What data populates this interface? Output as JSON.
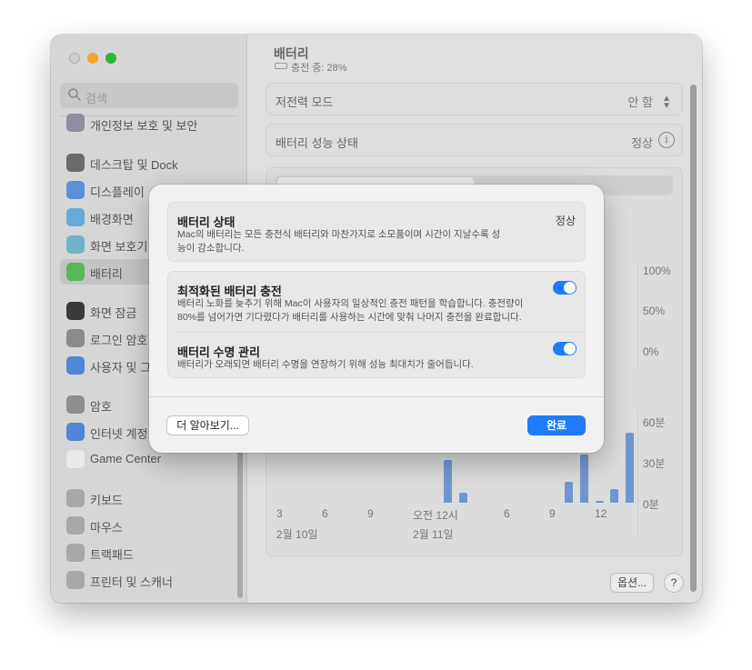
{
  "sidebar": {
    "search_placeholder": "검색",
    "items": [
      {
        "label": "개인정보 보호 및 보안",
        "icon": "hand-icon"
      },
      {
        "label": "데스크탑 및 Dock",
        "icon": "dock-icon"
      },
      {
        "label": "디스플레이",
        "icon": "display-icon"
      },
      {
        "label": "배경화면",
        "icon": "wallpaper-icon"
      },
      {
        "label": "화면 보호기",
        "icon": "screensaver-icon"
      },
      {
        "label": "배터리",
        "icon": "battery-icon",
        "selected": true
      },
      {
        "label": "화면 잠금",
        "icon": "lock-icon"
      },
      {
        "label": "로그인 암호",
        "icon": "lock-icon"
      },
      {
        "label": "사용자 및 그",
        "icon": "users-icon"
      },
      {
        "label": "암호",
        "icon": "key-icon"
      },
      {
        "label": "인터넷 계정",
        "icon": "at-icon"
      },
      {
        "label": "Game Center",
        "icon": "game-center-icon"
      },
      {
        "label": "키보드",
        "icon": "keyboard-icon"
      },
      {
        "label": "마우스",
        "icon": "mouse-icon"
      },
      {
        "label": "트랙패드",
        "icon": "trackpad-icon"
      },
      {
        "label": "프린터 및 스캐너",
        "icon": "printer-icon"
      }
    ]
  },
  "main": {
    "title": "배터리",
    "subtitle": "충전 중: 28%",
    "low_power_label": "저전력 모드",
    "low_power_value": "안 함",
    "health_label": "배터리 성능 상태",
    "health_value": "정상",
    "chart": {
      "level_ticks": [
        "100%",
        "50%",
        "0%"
      ],
      "usage_ticks": [
        "60분",
        "30분",
        "0분"
      ],
      "x_ticks": [
        "3",
        "6",
        "9",
        "오전 12시",
        "6",
        "9",
        "12"
      ],
      "date_labels": [
        "2월 10일",
        "2월 11일"
      ]
    },
    "options_button": "옵션...",
    "help_button": "?"
  },
  "chart_data": {
    "type": "bar",
    "categories": [
      "3",
      "6",
      "9",
      "오전 12시",
      "6",
      "9",
      "12"
    ],
    "ylabel": "",
    "ylim": [
      0,
      60
    ],
    "series": [
      {
        "values": [
          0,
          0,
          0,
          31,
          7,
          0,
          0,
          0,
          0,
          0,
          0,
          15,
          35,
          1,
          10,
          51
        ]
      }
    ]
  },
  "modal": {
    "status_title": "배터리 상태",
    "status_value": "정상",
    "status_desc": "Mac의 배터리는 모든 충전식 배터리와 마찬가지로 소모품이며 시간이 지날수록 성능이 감소합니다.",
    "optimized_title": "최적화된 배터리 충전",
    "optimized_desc": "배터리 노화를 늦추기 위해 Mac이 사용자의 일상적인 충전 패턴을 학습합니다. 충전량이 80%를 넘어가면 기다렸다가 배터리를 사용하는 시간에 맞춰 나머지 충전을 완료합니다.",
    "optimized_on": true,
    "lifespan_title": "배터리 수명 관리",
    "lifespan_desc": "배터리가 오래되면 배터리 수명을 연장하기 위해 성능 최대치가 줄어듭니다.",
    "lifespan_on": true,
    "learn_more": "더 알아보기...",
    "done": "완료"
  },
  "colors": {
    "accent": "#1f7cf6",
    "bar": "#6e97d0"
  }
}
